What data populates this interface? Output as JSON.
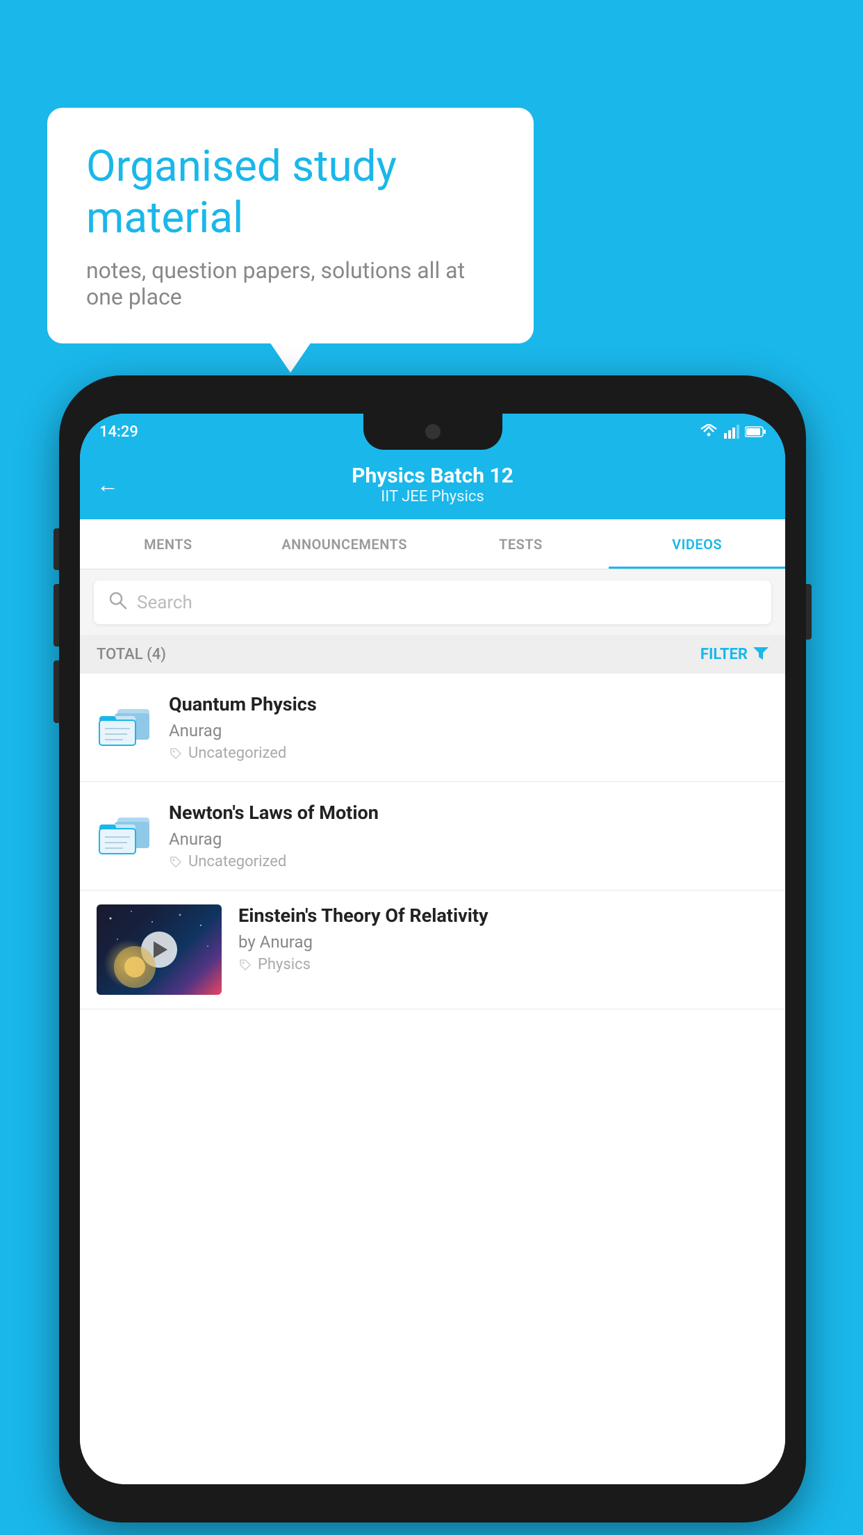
{
  "background_color": "#1ab7ea",
  "bubble": {
    "title": "Organised study material",
    "subtitle": "notes, question papers, solutions all at one place"
  },
  "status_bar": {
    "time": "14:29",
    "wifi": "▼",
    "signal": "▲",
    "battery": "▓"
  },
  "header": {
    "back_arrow": "←",
    "title": "Physics Batch 12",
    "subtitle": "IIT JEE   Physics"
  },
  "tabs": [
    {
      "label": "MENTS",
      "active": false
    },
    {
      "label": "ANNOUNCEMENTS",
      "active": false
    },
    {
      "label": "TESTS",
      "active": false
    },
    {
      "label": "VIDEOS",
      "active": true
    }
  ],
  "search": {
    "placeholder": "Search"
  },
  "filter_bar": {
    "total": "TOTAL (4)",
    "filter_label": "FILTER"
  },
  "videos": [
    {
      "title": "Quantum Physics",
      "author": "Anurag",
      "category": "Uncategorized",
      "has_thumbnail": false
    },
    {
      "title": "Newton's Laws of Motion",
      "author": "Anurag",
      "category": "Uncategorized",
      "has_thumbnail": false
    },
    {
      "title": "Einstein's Theory Of Relativity",
      "author": "by Anurag",
      "category": "Physics",
      "has_thumbnail": true
    }
  ]
}
